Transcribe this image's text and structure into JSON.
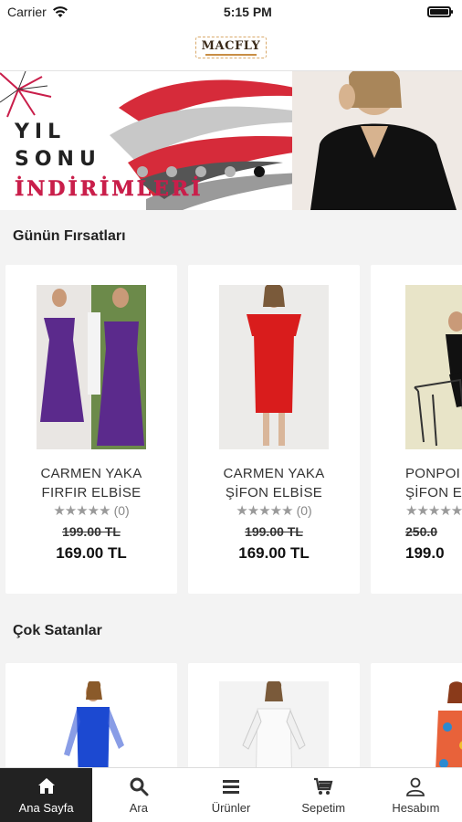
{
  "status": {
    "carrier": "Carrier",
    "time": "5:15 PM",
    "battery_level": 0.9
  },
  "header": {
    "logo_text": "MACFLY"
  },
  "banner": {
    "line1": "YIL",
    "line2": "SONU",
    "line3": "İNDİRİMLERİ",
    "dots": 5,
    "active_dot": 4
  },
  "deals": {
    "title": "Günün Fırsatları",
    "items": [
      {
        "name_line1": "CARMEN YAKA",
        "name_line2": "FIRFIR ELBİSE",
        "stars": "★★★★★",
        "reviews": "(0)",
        "old_price": "199.00 TL",
        "price": "169.00 TL",
        "dress_color": "#5b2a8c"
      },
      {
        "name_line1": "CARMEN YAKA",
        "name_line2": "ŞİFON ELBİSE",
        "stars": "★★★★★",
        "reviews": "(0)",
        "old_price": "199.00 TL",
        "price": "169.00 TL",
        "dress_color": "#d91c1c"
      },
      {
        "name_line1": "PONPOI",
        "name_line2": "ŞİFON E",
        "stars": "★★★★★",
        "reviews": "",
        "old_price": "250.0",
        "price": "199.0",
        "dress_color": "#111111"
      }
    ]
  },
  "bestsellers": {
    "title": "Çok Satanlar",
    "items": [
      {
        "dress_color": "#1c49d1"
      },
      {
        "dress_color": "#f4f4f4"
      },
      {
        "dress_color": "#e8623a"
      }
    ]
  },
  "tabbar": {
    "items": [
      {
        "label": "Ana Sayfa",
        "icon": "home-icon"
      },
      {
        "label": "Ara",
        "icon": "search-icon"
      },
      {
        "label": "Ürünler",
        "icon": "menu-icon"
      },
      {
        "label": "Sepetim",
        "icon": "cart-icon"
      },
      {
        "label": "Hesabım",
        "icon": "user-icon"
      }
    ],
    "active": 0
  }
}
